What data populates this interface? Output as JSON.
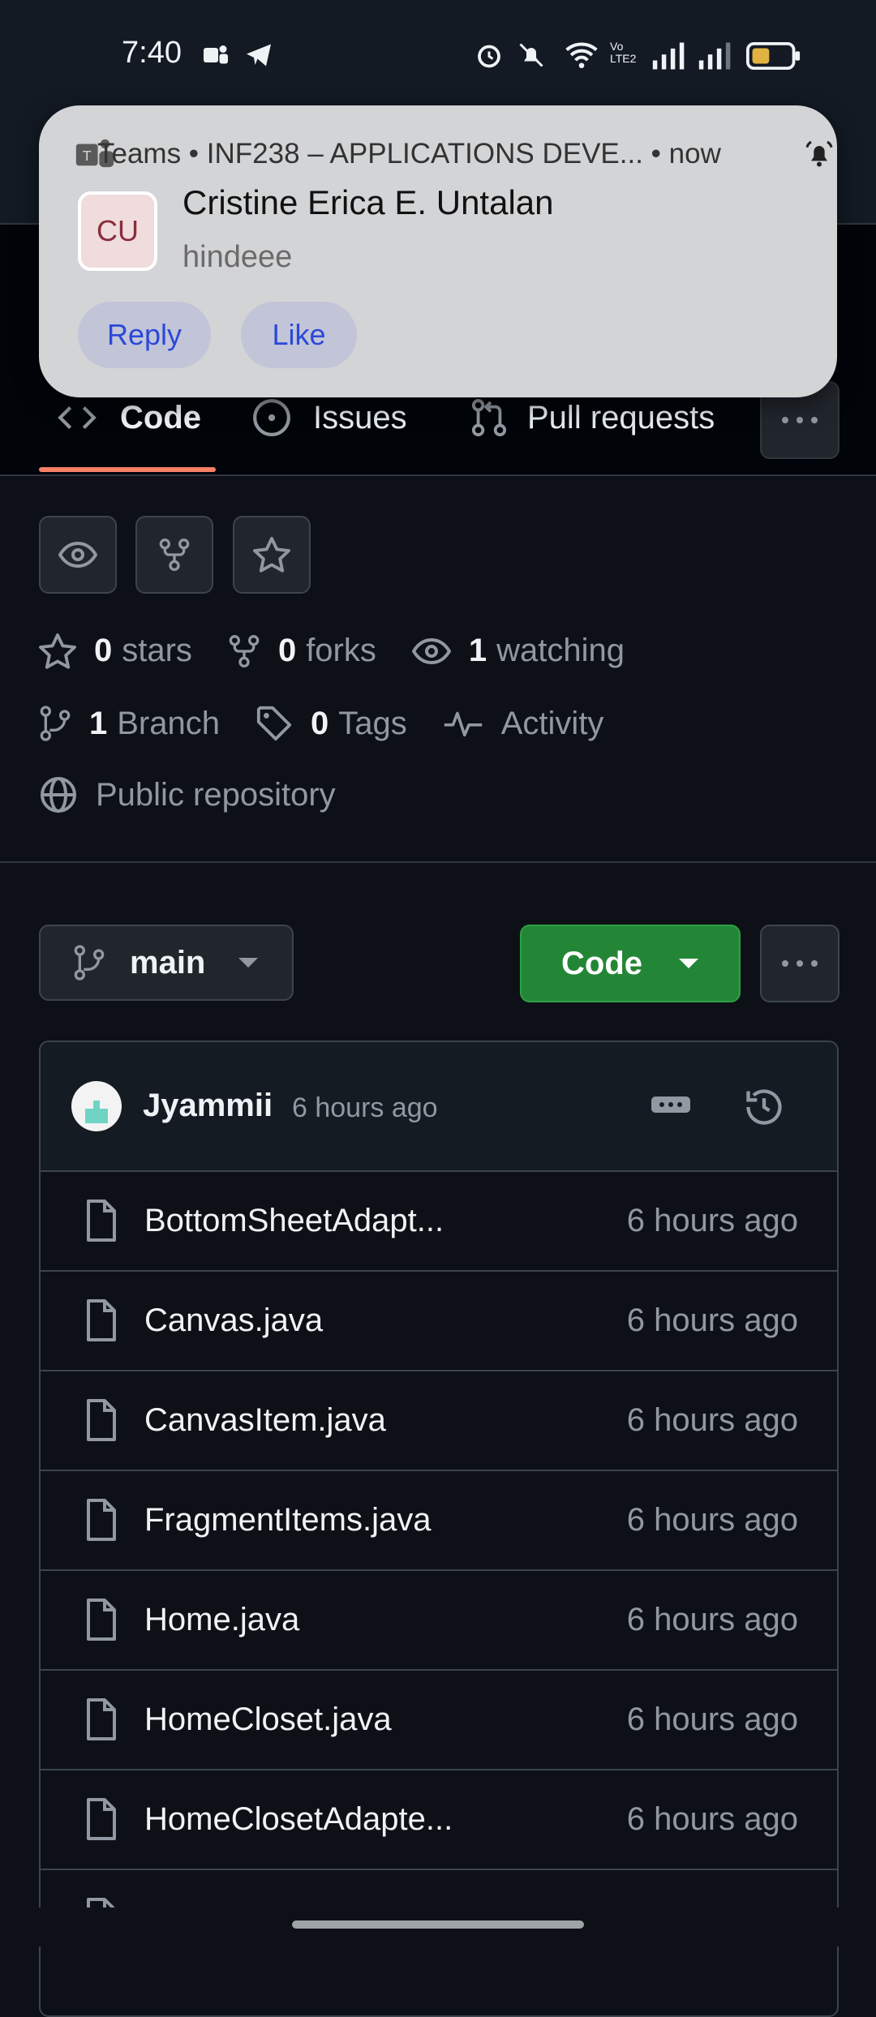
{
  "status_bar": {
    "time": "7:40"
  },
  "notification": {
    "app_line": "Teams • INF238 – APPLICATIONS DEVE...  • now",
    "avatar_initials": "CU",
    "sender": "Cristine Erica E. Untalan",
    "message": "hindeee",
    "actions": [
      "Reply",
      "Like"
    ]
  },
  "tabs": [
    {
      "label": "Code",
      "icon": "code-icon",
      "selected": true
    },
    {
      "label": "Issues",
      "icon": "issue-icon"
    },
    {
      "label": "Pull requests",
      "icon": "pull-request-icon"
    }
  ],
  "repo_stats": {
    "stars_count": "0",
    "stars_label": "stars",
    "forks_count": "0",
    "forks_label": "forks",
    "watching_count": "1",
    "watching_label": "watching",
    "branch_count": "1",
    "branch_label": "Branch",
    "tags_count": "0",
    "tags_label": "Tags",
    "activity_label": "Activity",
    "visibility": "Public repository"
  },
  "branch_selector": {
    "label": "main"
  },
  "code_button": {
    "label": "Code"
  },
  "commit": {
    "author": "Jyammii",
    "time": "6 hours ago"
  },
  "files": [
    {
      "name": "BottomSheetAdapt...",
      "time": "6 hours ago"
    },
    {
      "name": "Canvas.java",
      "time": "6 hours ago"
    },
    {
      "name": "CanvasItem.java",
      "time": "6 hours ago"
    },
    {
      "name": "FragmentItems.java",
      "time": "6 hours ago"
    },
    {
      "name": "Home.java",
      "time": "6 hours ago"
    },
    {
      "name": "HomeCloset.java",
      "time": "6 hours ago"
    },
    {
      "name": "HomeClosetAdapte...",
      "time": "6 hours ago"
    }
  ],
  "colors": {
    "accent_green": "#238636",
    "tab_underline": "#f78166",
    "background": "#0d1117"
  }
}
